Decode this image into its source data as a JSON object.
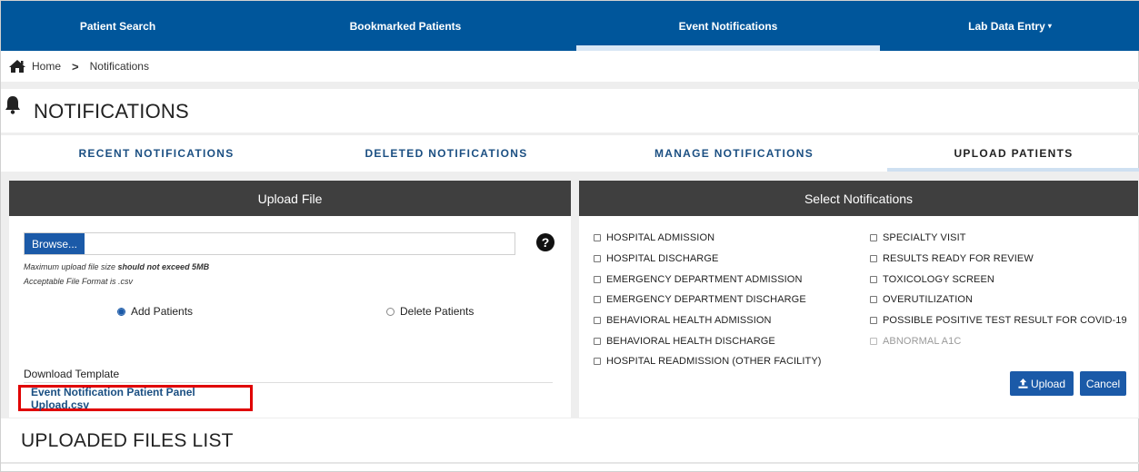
{
  "nav": {
    "items": [
      {
        "label": "Patient Search"
      },
      {
        "label": "Bookmarked Patients"
      },
      {
        "label": "Event Notifications"
      },
      {
        "label": "Lab Data Entry"
      }
    ],
    "active": "Event Notifications",
    "caret": "▾"
  },
  "breadcrumb": {
    "home": "Home",
    "separator": ">",
    "current": "Notifications"
  },
  "page_title": "NOTIFICATIONS",
  "tabs": [
    {
      "label": "RECENT NOTIFICATIONS"
    },
    {
      "label": "DELETED NOTIFICATIONS"
    },
    {
      "label": "MANAGE NOTIFICATIONS"
    },
    {
      "label": "UPLOAD PATIENTS"
    }
  ],
  "active_tab": "UPLOAD PATIENTS",
  "upload_file": {
    "header": "Upload File",
    "browse_label": "Browse...",
    "file_value": "",
    "help_glyph": "?",
    "hint_size_prefix": "Maximum upload file size ",
    "hint_size_bold": "should not exceed 5MB",
    "hint_format": "Acceptable File Format is .csv",
    "radio_add": "Add Patients",
    "radio_delete": "Delete Patients",
    "selected_radio": "Add Patients",
    "download_label": "Download Template",
    "download_link": "Event Notification Patient Panel Upload.csv"
  },
  "select_notifications": {
    "header": "Select Notifications",
    "left": [
      "HOSPITAL ADMISSION",
      "HOSPITAL DISCHARGE",
      "EMERGENCY DEPARTMENT ADMISSION",
      "EMERGENCY DEPARTMENT DISCHARGE",
      "BEHAVIORAL HEALTH ADMISSION",
      "BEHAVIORAL HEALTH DISCHARGE",
      "HOSPITAL READMISSION (OTHER FACILITY)"
    ],
    "right": [
      "SPECIALTY VISIT",
      "RESULTS READY FOR REVIEW",
      "TOXICOLOGY SCREEN",
      "OVERUTILIZATION",
      "POSSIBLE POSITIVE TEST RESULT FOR COVID-19",
      "ABNORMAL A1C"
    ],
    "disabled": [
      "ABNORMAL A1C"
    ],
    "upload_label": "Upload",
    "cancel_label": "Cancel"
  },
  "uploaded_files_title": "UPLOADED FILES LIST",
  "colors": {
    "nav_bg": "#00569b",
    "primary_button": "#1b5aa8",
    "panel_header": "#3f3f3f",
    "highlight_box": "#e00000"
  },
  "icons": [
    "home-icon",
    "chevron-right-icon",
    "bell-icon",
    "help-icon",
    "upload-icon"
  ]
}
